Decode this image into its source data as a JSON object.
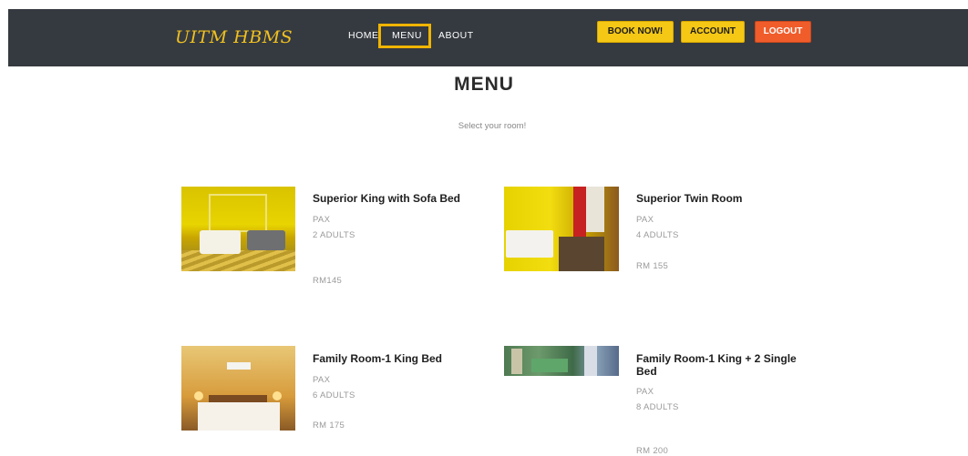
{
  "nav": {
    "brand": "UITM HBMS",
    "links": [
      {
        "label": "HOME"
      },
      {
        "label": "MENU",
        "active": true
      },
      {
        "label": "ABOUT"
      }
    ],
    "buttons": {
      "book": "BOOK NOW!",
      "account": "ACCOUNT",
      "logout": "LOGOUT"
    }
  },
  "colors": {
    "navbar": "#353a40",
    "brand": "#f0c020",
    "active_outline": "#f0b400",
    "book_button": "#f5c816",
    "account_button": "#f5c816",
    "logout_button": "#f05c2a"
  },
  "main": {
    "title": "MENU",
    "subtitle": "Select your room!",
    "rooms": [
      {
        "name": "Superior King with Sofa Bed",
        "pax_label": "PAX",
        "pax": "2 ADULTS",
        "price": "RM145",
        "image": "yellow-room-with-sofa"
      },
      {
        "name": "Superior Twin Room",
        "pax_label": "PAX",
        "pax": "4 ADULTS",
        "price": "RM 155",
        "image": "yellow-twin-room"
      },
      {
        "name": "Family Room-1 King Bed",
        "pax_label": "PAX",
        "pax": "6 ADULTS",
        "price": "RM 175",
        "image": "warm-king-bed-room"
      },
      {
        "name": "Family Room-1 King + 2 Single Bed",
        "pax_label": "PAX",
        "pax": "8 ADULTS",
        "price": "RM 200",
        "image": "panoramic-green-room"
      }
    ]
  }
}
